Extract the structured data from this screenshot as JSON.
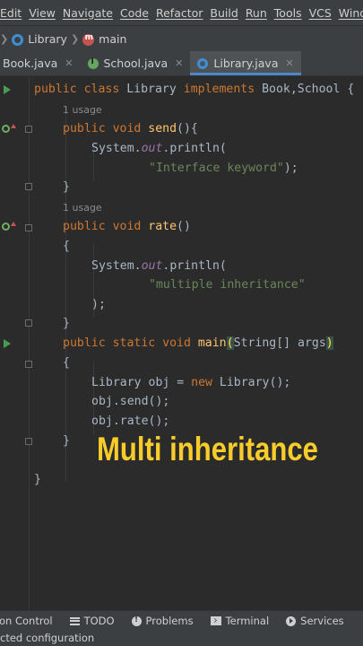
{
  "menu": [
    "Edit",
    "View",
    "Navigate",
    "Code",
    "Refactor",
    "Build",
    "Run",
    "Tools",
    "VCS",
    "Window"
  ],
  "breadcrumb": {
    "class_name": "Library",
    "method_name": "main"
  },
  "tabs": [
    {
      "label": "Book.java",
      "active": false
    },
    {
      "label": "School.java",
      "active": false
    },
    {
      "label": "Library.java",
      "active": true
    }
  ],
  "code": {
    "l1": {
      "kw1": "public class ",
      "name": "Library ",
      "kw2": "implements ",
      "rest": "Book,School {"
    },
    "usage1": "1 usage",
    "l3": {
      "kw": "public void ",
      "fn": "send",
      "rest": "(){"
    },
    "l4": {
      "pre": "System.",
      "st": "out",
      "post": ".println("
    },
    "l5": {
      "str": "\"Interface keyword\"",
      "rest": ");"
    },
    "l6": "}",
    "usage2": "1 usage",
    "l8": {
      "kw": "public void ",
      "fn": "rate",
      "rest": "()"
    },
    "l9": "{",
    "l10": {
      "pre": "System.",
      "st": "out",
      "post": ".println("
    },
    "l11": {
      "str": "\"multiple inheritance\""
    },
    "l12": ");",
    "l13": "}",
    "l14": {
      "kw": "public static void ",
      "fn": "main",
      "paren1": "(",
      "mid": "String[] args",
      "paren2": ")"
    },
    "l15": "{",
    "l16": {
      "pre": "Library obj = ",
      "kw": "new ",
      "post": "Library();"
    },
    "l17": "obj.send();",
    "l18": "obj.rate();",
    "l19": "}",
    "l20": "}"
  },
  "overlay_caption": "Multi inheritance",
  "bottom_tools": [
    {
      "label": "on Control",
      "icon": ""
    },
    {
      "label": "TODO",
      "icon": "todo-icon"
    },
    {
      "label": "Problems",
      "icon": "problems-icon"
    },
    {
      "label": "Terminal",
      "icon": "terminal-icon"
    },
    {
      "label": "Services",
      "icon": "services-icon"
    }
  ],
  "status_text": "cted configuration",
  "colors": {
    "keyword": "#cc7832",
    "method": "#ffc66d",
    "string": "#6a8759",
    "static_field": "#9876aa",
    "caption": "#f7cc2b"
  }
}
